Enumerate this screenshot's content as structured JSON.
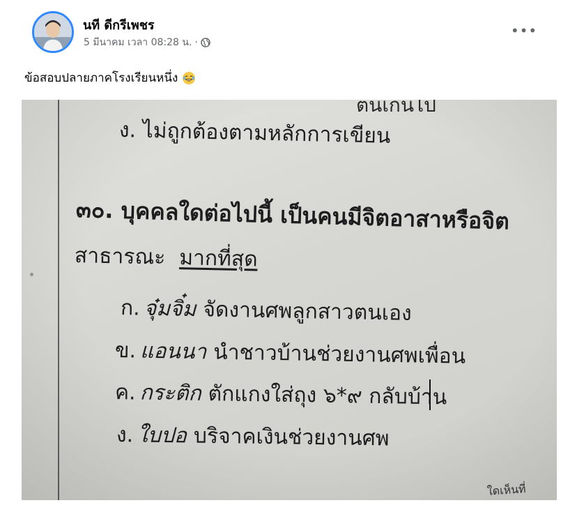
{
  "post": {
    "author_name": "นที ดีกรีเพชร",
    "timestamp": "5 มีนาคม เวลา 08:28 น.",
    "separator": "·",
    "privacy_icon": "globe-icon",
    "more_label": "•••",
    "caption": "ข้อสอบปลายภาคโรงเรียนหนึ่ง",
    "caption_emoji": "laughing-face-emoji"
  },
  "photo": {
    "cut_top_text": "ตนเกินไป",
    "line_top": "ง. ไม่ถูกต้องตามหลักการเขียน",
    "question_line1": "๓๐. บุคคลใดต่อไปนี้ เป็นคนมีจิตอาสาหรือจิต",
    "question_line2_start": "สาธารณะ",
    "question_line2_emphasis": "มากที่สุด",
    "choices": [
      {
        "prefix": "ก.",
        "name": "จุ๋มจิ๋ม",
        "text": "จัดงานศพลูกสาวตนเอง"
      },
      {
        "prefix": "ข.",
        "name": "แอนนา",
        "text": "นำชาวบ้านช่วยงานศพเพื่อน"
      },
      {
        "prefix": "ค.",
        "name": "กระติก",
        "text": "ตักแกงใส่ถุง ๖*๙ กลับบ้าน"
      },
      {
        "prefix": "ง.",
        "name": "ใบปอ",
        "text": "บริจาคเงินช่วยงานศพ"
      }
    ],
    "corner_text": "ใดเห็นที่"
  }
}
